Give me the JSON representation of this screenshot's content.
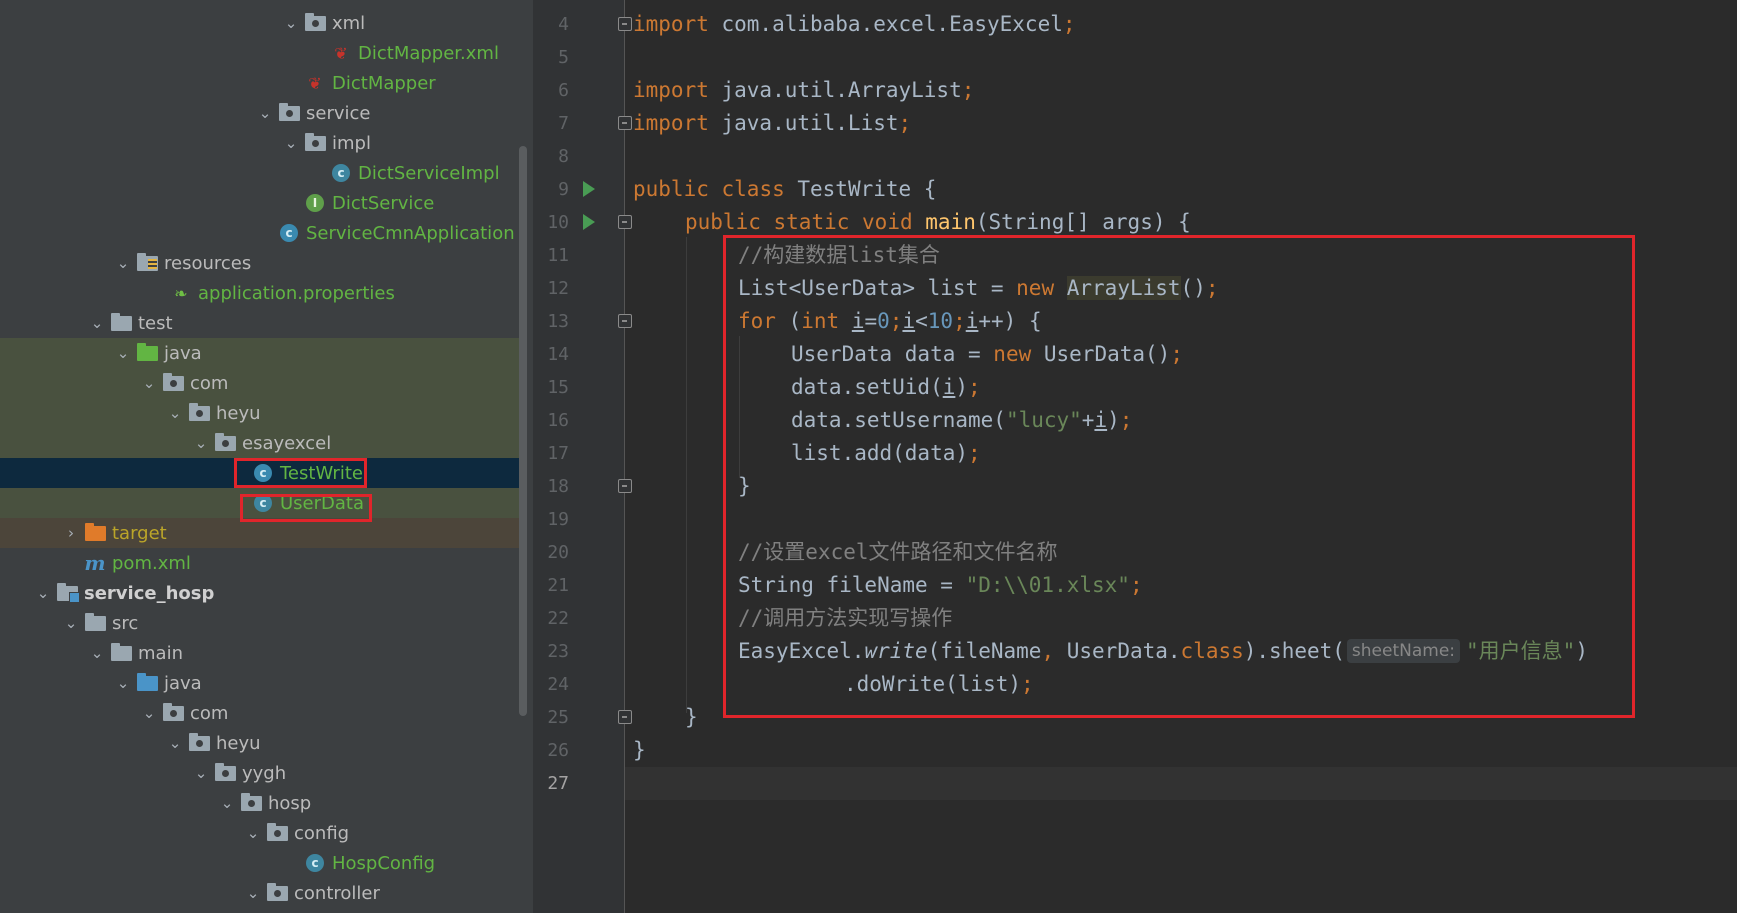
{
  "colors": {
    "tree_bg": "#3c3f41",
    "editor_bg": "#2b2b2b",
    "selection": "#0d293e",
    "highlight_border": "#e0252b",
    "keyword": "#cc7832",
    "string": "#6a8759",
    "number": "#6897bb",
    "comment": "#808080"
  },
  "project_tree": {
    "items": [
      {
        "label": "xml",
        "icon": "folder-icon"
      },
      {
        "label": "DictMapper.xml",
        "icon": "mybatis-icon"
      },
      {
        "label": "DictMapper",
        "icon": "mybatis-icon"
      },
      {
        "label": "service",
        "icon": "package-icon"
      },
      {
        "label": "impl",
        "icon": "package-icon"
      },
      {
        "label": "DictServiceImpl",
        "icon": "class-icon"
      },
      {
        "label": "DictService",
        "icon": "interface-icon"
      },
      {
        "label": "ServiceCmnApplication",
        "icon": "spring-boot-class-icon"
      },
      {
        "label": "resources",
        "icon": "resources-folder-icon"
      },
      {
        "label": "application.properties",
        "icon": "spring-properties-icon"
      },
      {
        "label": "test",
        "icon": "folder-icon"
      },
      {
        "label": "java",
        "icon": "test-source-folder-icon"
      },
      {
        "label": "com",
        "icon": "package-icon"
      },
      {
        "label": "heyu",
        "icon": "package-icon"
      },
      {
        "label": "esayexcel",
        "icon": "package-icon"
      },
      {
        "label": "TestWrite",
        "icon": "runnable-class-icon"
      },
      {
        "label": "UserData",
        "icon": "class-icon"
      },
      {
        "label": "target",
        "icon": "excluded-folder-icon"
      },
      {
        "label": "pom.xml",
        "icon": "maven-icon"
      },
      {
        "label": "service_hosp",
        "icon": "module-folder-icon"
      },
      {
        "label": "src",
        "icon": "folder-icon"
      },
      {
        "label": "main",
        "icon": "folder-icon"
      },
      {
        "label": "java",
        "icon": "source-folder-icon"
      },
      {
        "label": "com",
        "icon": "package-icon"
      },
      {
        "label": "heyu",
        "icon": "package-icon"
      },
      {
        "label": "yygh",
        "icon": "package-icon"
      },
      {
        "label": "hosp",
        "icon": "package-icon"
      },
      {
        "label": "config",
        "icon": "package-icon"
      },
      {
        "label": "HospConfig",
        "icon": "class-icon"
      },
      {
        "label": "controller",
        "icon": "package-icon"
      }
    ]
  },
  "editor": {
    "line_numbers": [
      "4",
      "5",
      "6",
      "7",
      "8",
      "9",
      "10",
      "11",
      "12",
      "13",
      "14",
      "15",
      "16",
      "17",
      "18",
      "19",
      "20",
      "21",
      "22",
      "23",
      "24",
      "25",
      "26",
      "27"
    ],
    "code": {
      "l4": {
        "kw": "import",
        "rest": " com.alibaba.excel.EasyExcel",
        "semi": ";"
      },
      "l6": {
        "kw": "import",
        "rest": " java.util.ArrayList",
        "semi": ";"
      },
      "l7": {
        "kw": "import",
        "rest": " java.util.List",
        "semi": ";"
      },
      "l9": {
        "kw1": "public",
        "kw2": "class",
        "rest": " TestWrite {"
      },
      "l10": {
        "kw1": "public",
        "kw2": "static",
        "kw3": "void",
        "fn": "main",
        "rest": "(String[] args) {"
      },
      "l11": {
        "comment": "//构建数据list集合"
      },
      "l12": {
        "a": "List<UserData> list = ",
        "kw": "new",
        "b": " ",
        "hl": "ArrayList",
        "c": "()",
        "semi": ";"
      },
      "l13": {
        "kw": "for",
        "a": " (",
        "kw2": "int",
        "b": " ",
        "v1": "i",
        "eq": "=",
        "n0": "0",
        "s1": ";",
        "v2": "i",
        "lt": "<",
        "n10": "10",
        "s2": ";",
        "v3": "i",
        "c": "++) {"
      },
      "l14": {
        "a": "UserData data = ",
        "kw": "new",
        "b": " UserData()",
        "semi": ";"
      },
      "l15": {
        "a": "data.setUid(",
        "v": "i",
        "b": ")",
        "semi": ";"
      },
      "l16": {
        "a": "data.setUsername(",
        "str": "\"lucy\"",
        "b": "+",
        "v": "i",
        "c": ")",
        "semi": ";"
      },
      "l17": {
        "a": "list.add(data)",
        "semi": ";"
      },
      "l18": {
        "a": "}"
      },
      "l20": {
        "comment": "//设置excel文件路径和文件名称"
      },
      "l21": {
        "a": "String fileName = ",
        "str": "\"D:\\\\01.xlsx\"",
        "semi": ";"
      },
      "l22": {
        "comment": "//调用方法实现写操作"
      },
      "l23": {
        "a": "EasyExcel.",
        "it": "write",
        "b": "(fileName",
        "comma": ",",
        "c": " UserData.",
        "kw": "class",
        "d": ").sheet(",
        "hint": "sheetName:",
        "str": "\"用户信息\"",
        "e": ")"
      },
      "l24": {
        "a": ".doWrite(list)",
        "semi": ";"
      },
      "l25": {
        "a": "}"
      },
      "l26": {
        "a": "}"
      }
    }
  }
}
